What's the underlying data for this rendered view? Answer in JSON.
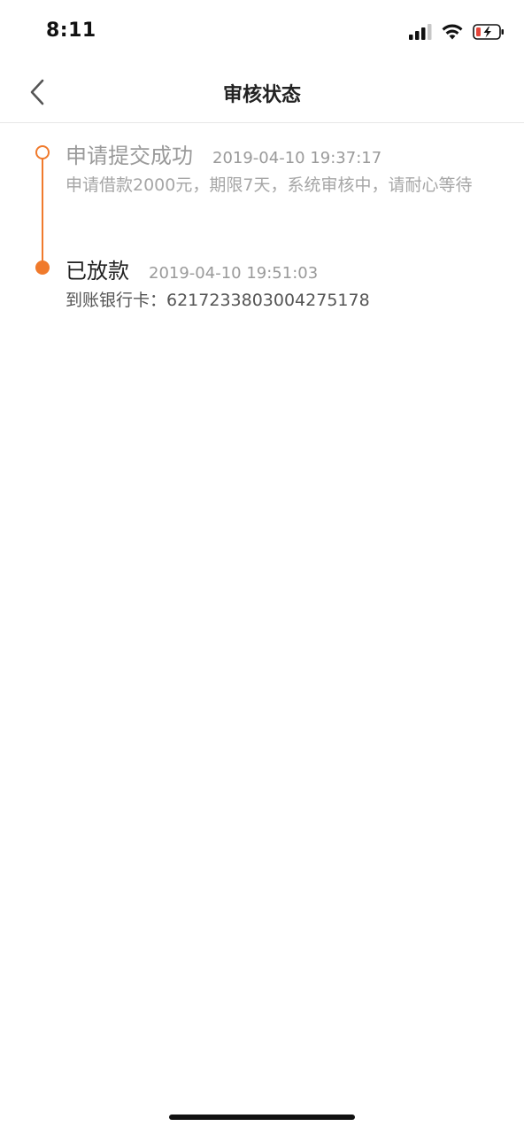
{
  "status_bar": {
    "time": "8:11",
    "icons": [
      "signal-icon",
      "wifi-icon",
      "battery-charging-icon"
    ]
  },
  "header": {
    "title": "审核状态",
    "back_icon": "chevron-left-icon"
  },
  "timeline": {
    "items": [
      {
        "title": "申请提交成功",
        "time": "2019-04-10 19:37:17",
        "description": "申请借款2000元，期限7天，系统审核中，请耐心等待",
        "state": "completed-hollow"
      },
      {
        "title": "已放款",
        "time": "2019-04-10 19:51:03",
        "description": "到账银行卡：6217233803004275178",
        "state": "current-filled"
      }
    ]
  },
  "colors": {
    "accent": "#f07a2c",
    "text_primary": "#222222",
    "text_muted": "#9a9a9a",
    "divider": "#e6e6e6",
    "battery_low": "#e5453a"
  }
}
